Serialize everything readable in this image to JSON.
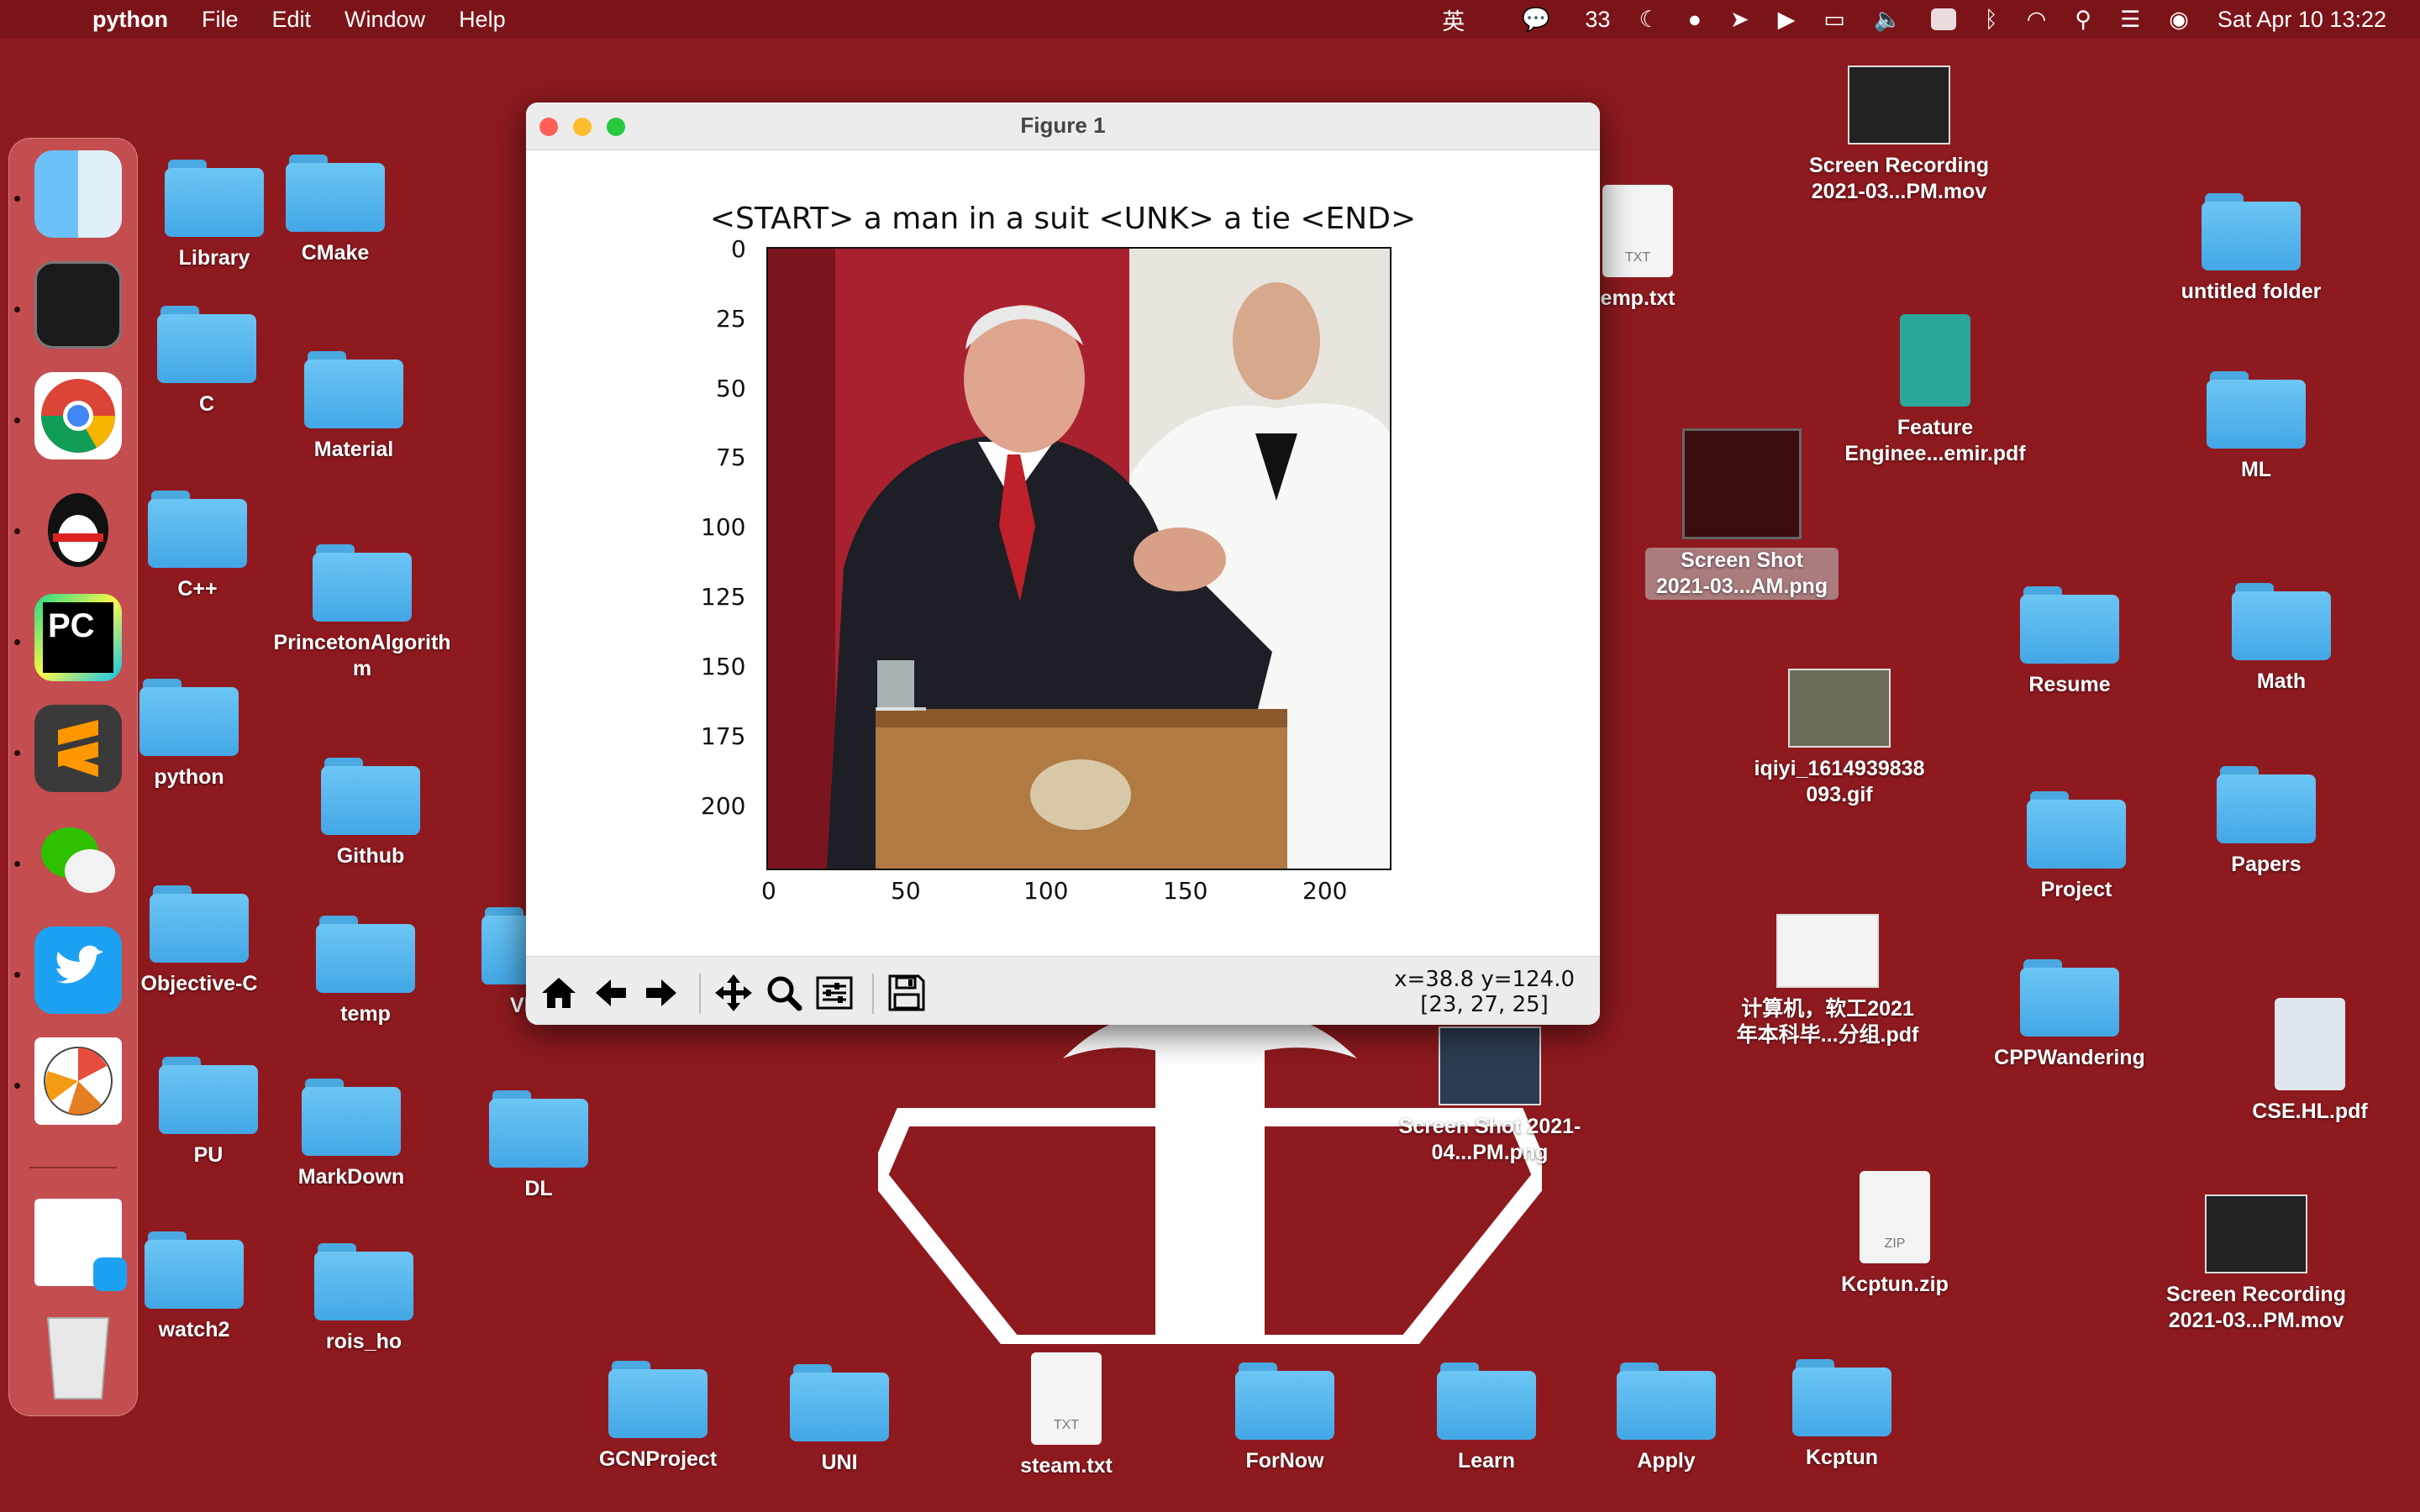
{
  "menubar": {
    "app": "python",
    "items": [
      "File",
      "Edit",
      "Window",
      "Help"
    ],
    "input_method": "英",
    "wechat_count": "33",
    "datetime": "Sat Apr 10  13:22"
  },
  "window": {
    "title": "Figure 1",
    "plot_title": "<START> a man in a suit <UNK> a tie <END>",
    "y_ticks": [
      "0",
      "25",
      "50",
      "75",
      "100",
      "125",
      "150",
      "175",
      "200"
    ],
    "x_ticks": [
      "0",
      "50",
      "100",
      "150",
      "200"
    ],
    "coords_line1": "x=38.8 y=124.0",
    "coords_line2": "[23, 27, 25]"
  },
  "desktop": {
    "library": "Library",
    "cmake": "CMake",
    "c": "C",
    "material": "Material",
    "cpp": "C++",
    "princeton": "PrincetonAlgorith m",
    "python": "python",
    "github": "Github",
    "objc": "Objective-C",
    "temp": "temp",
    "vps": "VPS",
    "pu": "PU",
    "markdown": "MarkDown",
    "dl": "DL",
    "watch2": "watch2",
    "rois": "rois_ho",
    "gcn": "GCNProject",
    "uni": "UNI",
    "steam": "steam.txt",
    "fornow": "ForNow",
    "learn": "Learn",
    "apply": "Apply",
    "kcptun": "Kcptun",
    "emptxt": "emp.txt",
    "screenrec1": "Screen Recording 2021-03...PM.mov",
    "feature": "Feature Enginee...emir.pdf",
    "screenshot1": "Screen Shot 2021-03...AM.png",
    "iqiyi": "iqiyi_1614939838 093.gif",
    "jisuanji": "计算机，软工2021 年本科毕...分组.pdf",
    "screenshot2": "Screen Shot 2021-04...PM.png",
    "kcptunzip": "Kcptun.zip",
    "untitled": "untitled folder",
    "ml": "ML",
    "resume": "Resume",
    "math": "Math",
    "project": "Project",
    "papers": "Papers",
    "cppwandering": "CPPWandering",
    "csehl": "CSE.HL.pdf",
    "screenrec2": "Screen Recording 2021-03...PM.mov",
    "txt_badge": "TXT",
    "zip_badge": "ZIP"
  }
}
